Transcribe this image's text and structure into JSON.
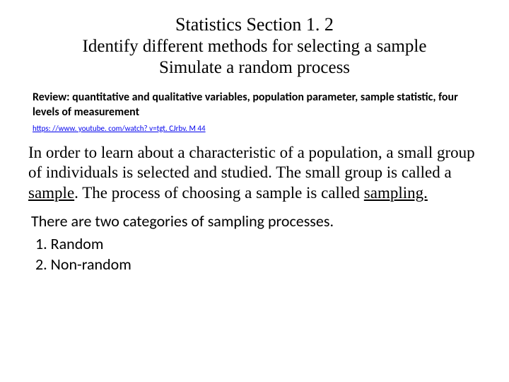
{
  "title": {
    "line1": "Statistics  Section 1. 2",
    "line2": "Identify different methods for selecting a sample",
    "line3": "Simulate a random process"
  },
  "review": "Review:  quantitative and qualitative variables, population parameter, sample statistic, four levels of measurement",
  "link": "https: //www. youtube. com/watch? v=tgt. CJrbv. M 44",
  "body": {
    "p1a": "In order to learn about a characteristic of a population, a small group of individuals is selected and studied.  The small group is called a ",
    "p1_sample": "sample",
    "p1b": ".  The process of choosing a sample is called ",
    "p1_sampling": "sampling.",
    "intro": "There are two categories of sampling processes.",
    "item1": "1.   Random",
    "item2": "2.   Non-random"
  }
}
